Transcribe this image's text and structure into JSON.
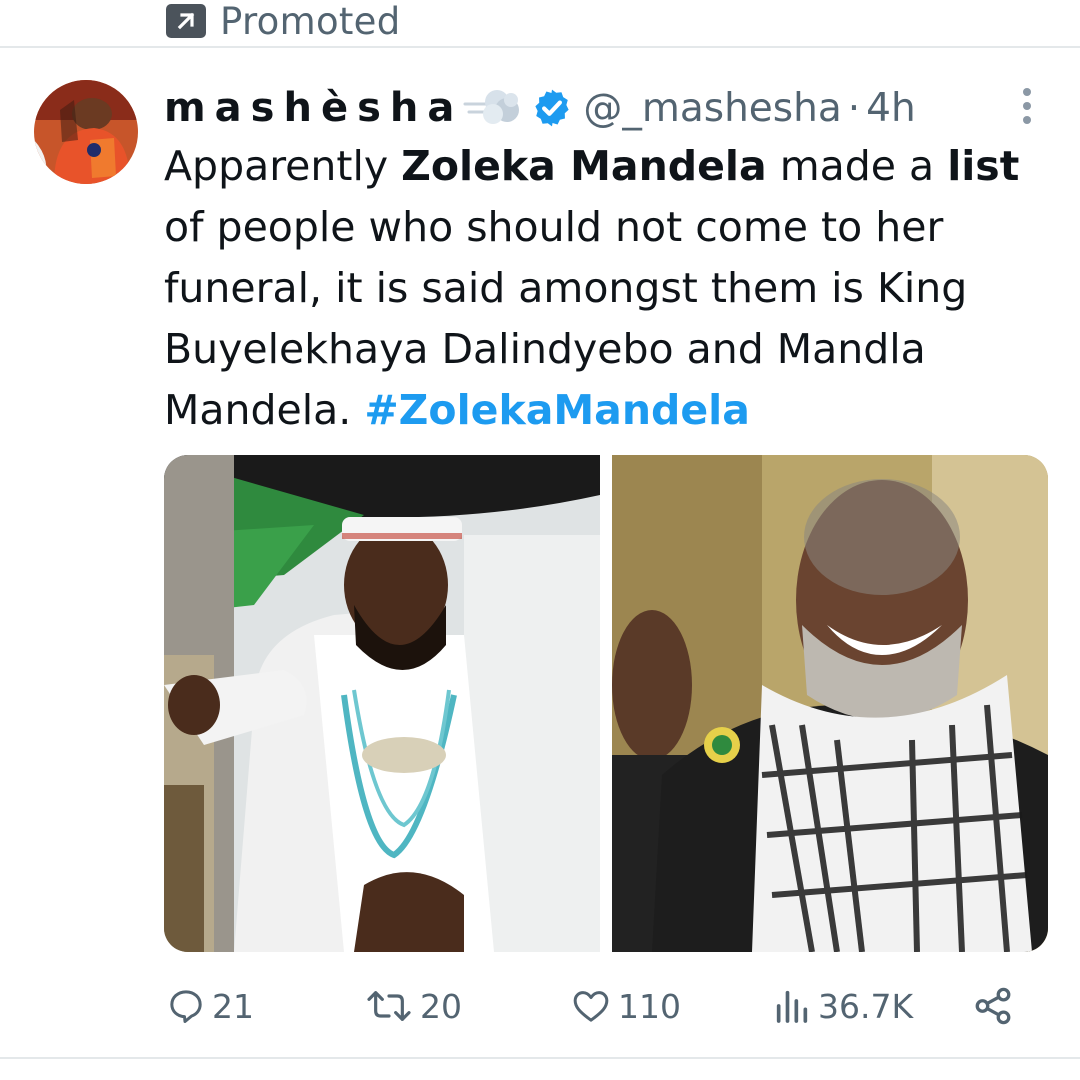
{
  "promoted": {
    "label": "Promoted"
  },
  "tweet": {
    "display_name": "mashèsha",
    "handle": "@_mashesha",
    "separator": "·",
    "time": "4h",
    "text": {
      "t1": "Apparently ",
      "b1": "Zoleka Mandela",
      "t2": " made a ",
      "b2": "list",
      "t3": " of people who should not come to her funeral, it is said amongst them is King Buyelekhaya Dalindyebo and Mandla Mandela. ",
      "hashtag": "#ZolekaMandela"
    }
  },
  "actions": {
    "replies": "21",
    "retweets": "20",
    "likes": "110",
    "views": "36.7K"
  },
  "colors": {
    "accent": "#1d9bf0",
    "text": "#0f1419",
    "secondary": "#536471",
    "divider": "#e4e8ea"
  },
  "icons": [
    "promoted-arrow-icon",
    "dash-emoji-icon",
    "verified-badge-icon",
    "more-options-icon",
    "reply-icon",
    "retweet-icon",
    "like-icon",
    "views-icon",
    "share-icon"
  ]
}
